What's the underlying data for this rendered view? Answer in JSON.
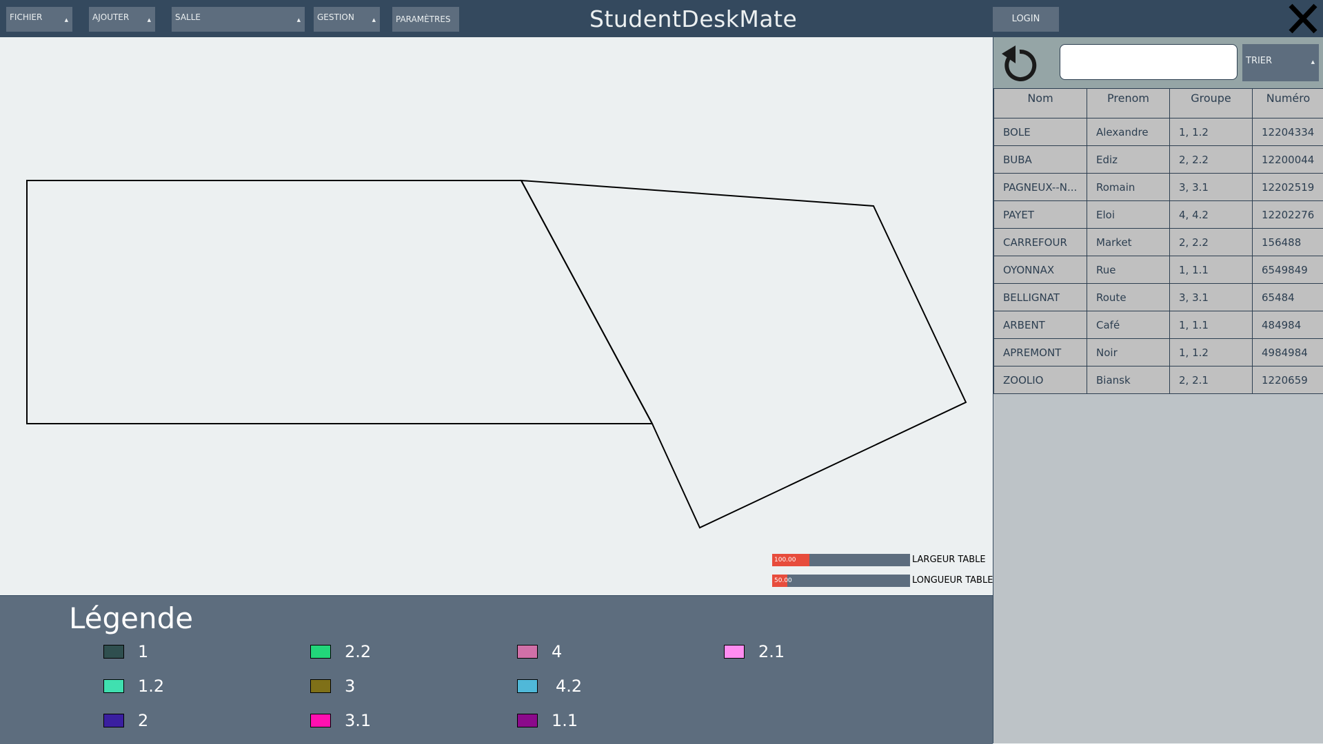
{
  "app": {
    "title": "StudentDeskMate"
  },
  "menubar": {
    "items": [
      {
        "label": "FICHIER",
        "has_caret": true
      },
      {
        "label": "AJOUTER",
        "has_caret": true
      },
      {
        "label": "SALLE",
        "has_caret": true
      },
      {
        "label": "GESTION",
        "has_caret": true
      },
      {
        "label": "PARAMÈTRES",
        "has_caret": false
      }
    ],
    "login_label": "LOGIN",
    "close_icon": "close-icon"
  },
  "sliders": [
    {
      "value_text": "100.00",
      "label": "LARGEUR TABLE",
      "fill_fraction": 0.27
    },
    {
      "value_text": "50.00",
      "label": "LONGUEUR TABLE",
      "fill_fraction": 0.11
    }
  ],
  "legend": {
    "title": "Légende",
    "items": [
      {
        "label": "1",
        "color": "#2f4f4f"
      },
      {
        "label": "1.2",
        "color": "#40e0b0"
      },
      {
        "label": "2",
        "color": "#3a1fa0"
      },
      {
        "label": "2.2",
        "color": "#22d67a"
      },
      {
        "label": "3",
        "color": "#7f7018"
      },
      {
        "label": "3.1",
        "color": "#ff10b0"
      },
      {
        "label": "4",
        "color": "#d070a8"
      },
      {
        "label": "4.2",
        "color": "#50b8d8"
      },
      {
        "label": "1.1",
        "color": "#8b0a8b"
      },
      {
        "label": "2.1",
        "color": "#ff8cf0"
      }
    ]
  },
  "sidebar": {
    "refresh_icon": "refresh-icon",
    "search": {
      "value": "",
      "placeholder": ""
    },
    "sort_label": "TRIER",
    "columns": [
      "Nom",
      "Prenom",
      "Groupe",
      "Numéro"
    ],
    "rows": [
      [
        "BOLE",
        "Alexandre",
        "1, 1.2",
        "12204334"
      ],
      [
        "BUBA",
        "Ediz",
        "2, 2.2",
        "12200044"
      ],
      [
        "PAGNEUX--N...",
        "Romain",
        "3, 3.1",
        "12202519"
      ],
      [
        "PAYET",
        "Eloi",
        "4,  4.2",
        "12202276"
      ],
      [
        "CARREFOUR",
        "Market",
        "2, 2.2",
        "156488"
      ],
      [
        "OYONNAX",
        "Rue",
        "1, 1.1",
        "6549849"
      ],
      [
        "BELLIGNAT",
        "Route",
        "3, 3.1",
        "65484"
      ],
      [
        "ARBENT",
        "Café",
        "1, 1.1",
        "484984"
      ],
      [
        "APREMONT",
        "Noir",
        "1, 1.2",
        "4984984"
      ],
      [
        "ZOOLIO",
        "Biansk",
        "2, 2.1",
        "1220659"
      ]
    ]
  },
  "colors": {
    "topbar": "#34495e",
    "button": "#5d6d7e",
    "slider_fill": "#e74c3c",
    "canvas": "#ecf0f1",
    "table_cell": "#c0c0c0"
  }
}
